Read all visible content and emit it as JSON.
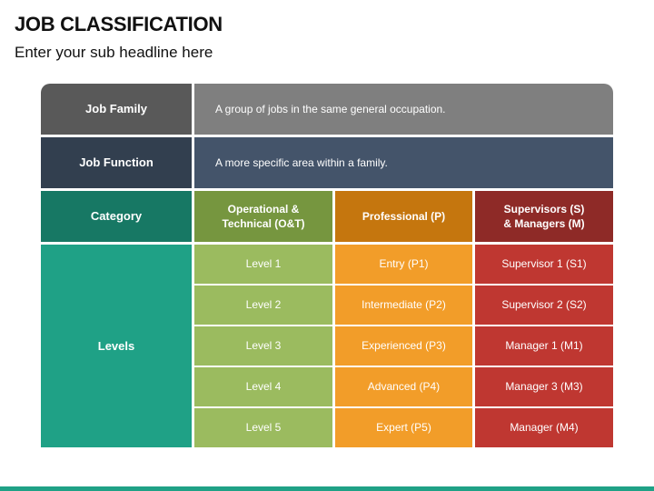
{
  "header": {
    "title": "JOB CLASSIFICATION",
    "subtitle": "Enter your sub headline here"
  },
  "table": {
    "job_family": {
      "label": "Job Family",
      "description": "A group of jobs in the same general occupation.",
      "label_color": "#595959",
      "desc_color": "#7f7f7f"
    },
    "job_function": {
      "label": "Job Function",
      "description": "A more specific area within a family.",
      "label_color": "#323f4f",
      "desc_color": "#44546a"
    },
    "category": {
      "label": "Category",
      "label_color": "#177864",
      "columns": [
        {
          "label": "Operational & Technical (O&T)",
          "header_color": "#76963f",
          "cell_color": "#9bbb5f"
        },
        {
          "label": "Professional (P)",
          "header_color": "#c5760e",
          "cell_color": "#f29d29"
        },
        {
          "label": "Supervisors (S) & Managers (M)",
          "header_color": "#8e2a27",
          "cell_color": "#bf3731"
        }
      ]
    },
    "levels": {
      "label": "Levels",
      "label_color": "#1fa186",
      "rows": [
        [
          "Level 1",
          "Entry (P1)",
          "Supervisor 1 (S1)"
        ],
        [
          "Level 2",
          "Intermediate (P2)",
          "Supervisor 2 (S2)"
        ],
        [
          "Level 3",
          "Experienced (P3)",
          "Manager 1 (M1)"
        ],
        [
          "Level 4",
          "Advanced (P4)",
          "Manager 3 (M3)"
        ],
        [
          "Level 5",
          "Expert (P5)",
          "Manager (M4)"
        ]
      ]
    }
  },
  "footer": {
    "bar_color": "#1fa186"
  }
}
